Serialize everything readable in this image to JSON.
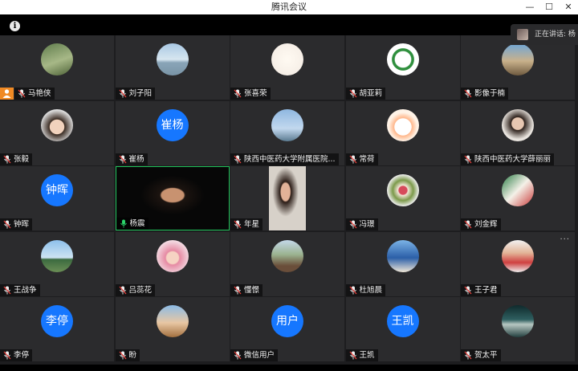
{
  "window": {
    "title": "腾讯会议",
    "controls": [
      "—",
      "☐",
      "✕"
    ]
  },
  "info_icon": "i",
  "speaking": {
    "text": "正在讲话: 杨"
  },
  "participants": [
    {
      "name": "马艳侠",
      "host": true,
      "avatar": {
        "type": "photo",
        "style": "linear-gradient(160deg,#5f7c4c,#a7b887 55%,#4c6136)"
      }
    },
    {
      "name": "刘子阳",
      "avatar": {
        "type": "photo",
        "style": "linear-gradient(180deg,#a9c8e3,#d7e6f0 50%,#8aa5b8 60%,#7a94a6)"
      }
    },
    {
      "name": "张喜荣",
      "avatar": {
        "type": "photo",
        "style": "radial-gradient(circle at 50% 50%,#fffaf2,#f3ebe3)"
      }
    },
    {
      "name": "胡亚莉",
      "avatar": {
        "type": "photo",
        "style": "radial-gradient(circle,#fff 35%,#2f8f3d 38%,#2f8f3d 48%,#fff 50%)"
      }
    },
    {
      "name": "影像于楠",
      "avatar": {
        "type": "photo",
        "style": "linear-gradient(180deg,#6ea6d8,#c9b18b 55%,#6f5a3f)"
      }
    },
    {
      "name": "张毅",
      "avatar": {
        "type": "photo",
        "style": "radial-gradient(circle at 50% 55%,#f1d2bd 30%,#3a2b22 32%,#ddd 70%)"
      }
    },
    {
      "name": "崔杨",
      "avatar": {
        "type": "text",
        "text": "崔杨"
      }
    },
    {
      "name": "陕西中医药大学附属医院...",
      "avatar": {
        "type": "photo",
        "style": "linear-gradient(180deg,#8fb7e0,#c2d8ee 60%,#5b7b91)"
      }
    },
    {
      "name": "常荷",
      "avatar": {
        "type": "photo",
        "style": "radial-gradient(circle at 50% 55%,#fff 35%,#ffb68a 37%,#fff3e7 60%)"
      }
    },
    {
      "name": "陕西中医药大学薛丽丽",
      "avatar": {
        "type": "photo",
        "style": "radial-gradient(circle at 50% 45%,#e7c7b1 25%,#2d211b 28%,#e9e4de 65%)"
      }
    },
    {
      "name": "钟晖",
      "avatar": {
        "type": "text",
        "text": "钟晖"
      }
    },
    {
      "name": "杨震",
      "active": true,
      "avatar": {
        "type": "video",
        "style": "radial-gradient(ellipse at 50% 45%,#c89270 14%,#1c1410 16%,#070707 40%)"
      }
    },
    {
      "name": "年星",
      "avatar": {
        "type": "video",
        "style": "radial-gradient(ellipse at 45% 40%,#e2b298 16%,#2b1d17 19%,#d7d1c9 45%)"
      }
    },
    {
      "name": "冯璟",
      "avatar": {
        "type": "photo",
        "style": "radial-gradient(circle,#d64b5b 18%,#f2e6d6 22%,#7c9a4b 45%,#eee 70%)"
      }
    },
    {
      "name": "刘金辉",
      "avatar": {
        "type": "photo",
        "style": "linear-gradient(135deg,#2a7c45,#f4f1e8 50%,#c93a3a)"
      }
    },
    {
      "name": "王战争",
      "avatar": {
        "type": "photo",
        "style": "linear-gradient(180deg,#8ec0eb,#cde3f2 55%,#3b6a3f 60%,#6c8f56)"
      }
    },
    {
      "name": "吕蕊花",
      "avatar": {
        "type": "photo",
        "style": "radial-gradient(circle at 50% 55%,#f6d3c3 25%,#e68aa3 30%,#f3d9e1 70%)"
      }
    },
    {
      "name": "懂憬",
      "avatar": {
        "type": "photo",
        "style": "linear-gradient(180deg,#c4d8ea,#9bb390 45%,#6a4e3a 80%)"
      }
    },
    {
      "name": "杜旭晨",
      "avatar": {
        "type": "photo",
        "style": "linear-gradient(180deg,#7bb3e6,#2b5fa8 55%,#f0e7d8)"
      }
    },
    {
      "name": "王子君",
      "more": "···",
      "avatar": {
        "type": "photo",
        "style": "linear-gradient(180deg,#f2f2f2,#e3b497 40%,#cf4040 70%,#eee)"
      }
    },
    {
      "name": "李停",
      "avatar": {
        "type": "text",
        "text": "李停"
      }
    },
    {
      "name": "盼",
      "avatar": {
        "type": "photo",
        "style": "linear-gradient(180deg,#8cbbe6,#e8c7a3 55%,#a2703f)"
      }
    },
    {
      "name": "微信用户",
      "avatar": {
        "type": "text",
        "text": "用户"
      }
    },
    {
      "name": "王凯",
      "avatar": {
        "type": "text",
        "text": "王凯"
      }
    },
    {
      "name": "贺太平",
      "avatar": {
        "type": "photo",
        "style": "linear-gradient(180deg,#0f2a2c,#2f5f60 45%,#b7c7c2 60%,#23403f)"
      }
    }
  ]
}
